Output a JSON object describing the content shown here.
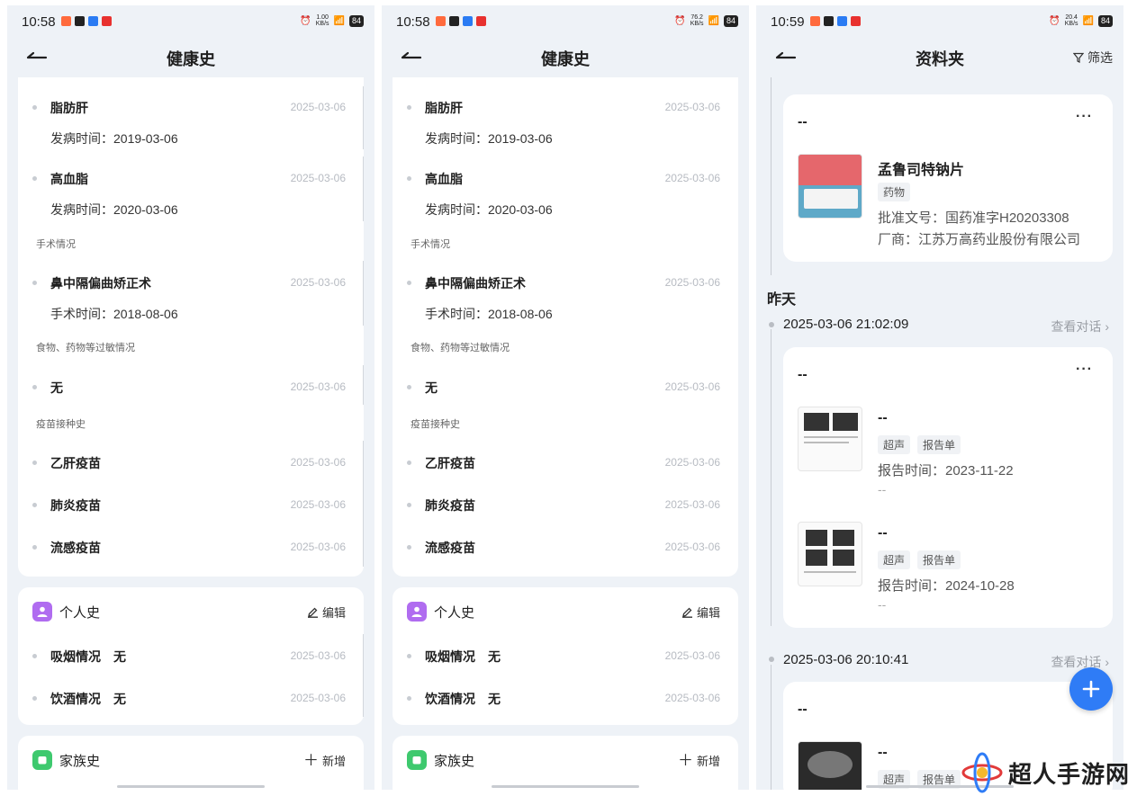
{
  "phone1": {
    "status": {
      "time": "10:58",
      "speed": "1.00",
      "speed_unit": "KB/s",
      "battery": "84"
    },
    "nav": {
      "title": "健康史"
    },
    "history": {
      "items": [
        {
          "title": "脂肪肝",
          "date": "2025-03-06",
          "sub": "发病时间：2019-03-06"
        },
        {
          "title": "高血脂",
          "date": "2025-03-06",
          "sub": "发病时间：2020-03-06"
        }
      ],
      "surgery_label": "手术情况",
      "surgery": {
        "title": "鼻中隔偏曲矫正术",
        "date": "2025-03-06",
        "sub": "手术时间：2018-08-06"
      },
      "allergy_label": "食物、药物等过敏情况",
      "allergy": {
        "title": "无",
        "date": "2025-03-06"
      },
      "vaccine_label": "疫苗接种史",
      "vaccines": [
        {
          "title": "乙肝疫苗",
          "date": "2025-03-06"
        },
        {
          "title": "肺炎疫苗",
          "date": "2025-03-06"
        },
        {
          "title": "流感疫苗",
          "date": "2025-03-06"
        }
      ]
    },
    "personal": {
      "title": "个人史",
      "action": "编辑",
      "items": [
        {
          "title": "吸烟情况　无",
          "date": "2025-03-06"
        },
        {
          "title": "饮酒情况　无",
          "date": "2025-03-06"
        }
      ]
    },
    "family": {
      "title": "家族史",
      "action": "新增"
    }
  },
  "phone2": {
    "status": {
      "time": "10:58",
      "speed": "76.2",
      "speed_unit": "KB/s",
      "battery": "84"
    }
  },
  "phone3": {
    "status": {
      "time": "10:59",
      "speed": "20.4",
      "speed_unit": "KB/s",
      "battery": "84"
    },
    "nav": {
      "title": "资料夹",
      "filter": "筛选"
    },
    "card1": {
      "header": "--",
      "more": "···",
      "item": {
        "title": "孟鲁司特钠片",
        "tag": "药物",
        "approval": "批准文号：国药准字H20203308",
        "maker": "厂商：江苏万高药业股份有限公司"
      }
    },
    "day_label": "昨天",
    "group1": {
      "datetime": "2025-03-06 21:02:09",
      "link": "查看对话"
    },
    "card2": {
      "header": "--",
      "more": "···",
      "items": [
        {
          "title": "--",
          "tags": [
            "超声",
            "报告单"
          ],
          "time": "报告时间：2023-11-22",
          "note": "--"
        },
        {
          "title": "--",
          "tags": [
            "超声",
            "报告单"
          ],
          "time": "报告时间：2024-10-28",
          "note": "--"
        }
      ]
    },
    "group2": {
      "datetime": "2025-03-06 20:10:41",
      "link": "查看对话"
    },
    "card3": {
      "header": "--",
      "item": {
        "title": "--",
        "tags": [
          "超声",
          "报告单"
        ]
      }
    }
  },
  "watermark": {
    "text": "超人手游网"
  },
  "colors": {
    "personal_icon": "#b06cf0",
    "family_icon": "#3ec96e",
    "fab": "#2f7cf6"
  }
}
